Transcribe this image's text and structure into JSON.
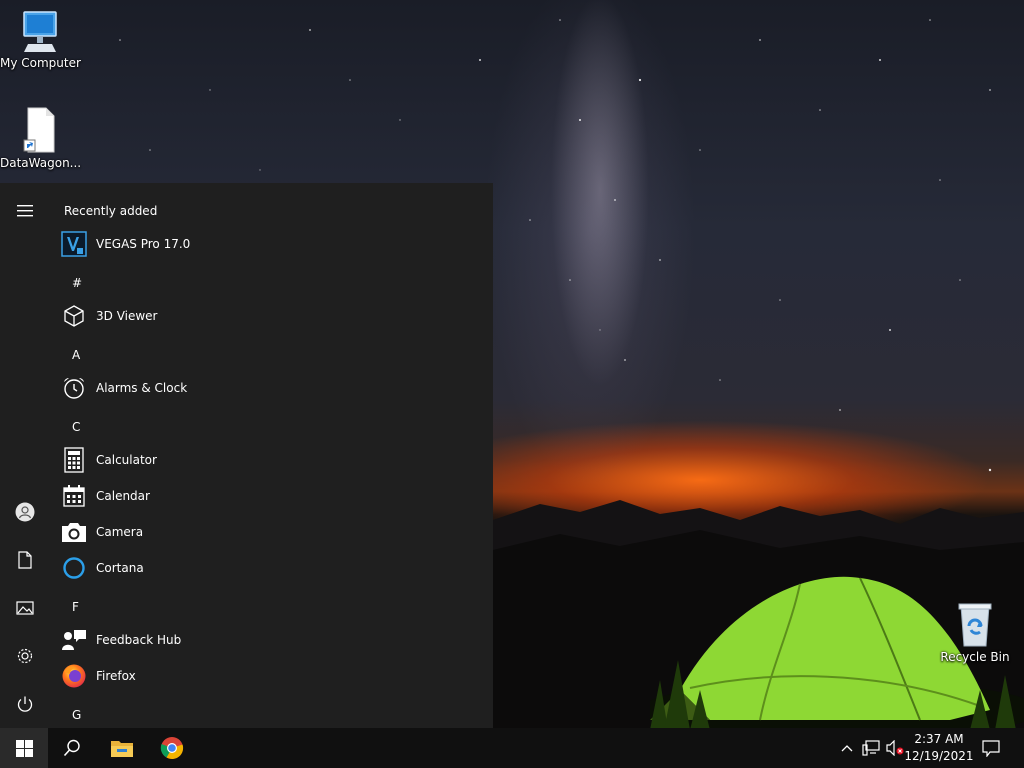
{
  "desktop": {
    "icons": [
      {
        "label": "My Computer",
        "icon": "monitor-icon"
      },
      {
        "label": "DataWagon...",
        "icon": "document-shortcut-icon"
      },
      {
        "label": "Recycle Bin",
        "icon": "recycle-bin-icon"
      }
    ]
  },
  "start_menu": {
    "recently_added_label": "Recently added",
    "letters": [
      "#",
      "A",
      "C",
      "F",
      "G"
    ],
    "apps": [
      {
        "name": "VEGAS Pro 17.0",
        "icon": "vegas-icon"
      },
      {
        "name": "3D Viewer",
        "icon": "cube-icon"
      },
      {
        "name": "Alarms & Clock",
        "icon": "alarm-clock-icon"
      },
      {
        "name": "Calculator",
        "icon": "calculator-icon"
      },
      {
        "name": "Calendar",
        "icon": "calendar-icon"
      },
      {
        "name": "Camera",
        "icon": "camera-icon"
      },
      {
        "name": "Cortana",
        "icon": "cortana-icon"
      },
      {
        "name": "Feedback Hub",
        "icon": "feedback-icon"
      },
      {
        "name": "Firefox",
        "icon": "firefox-icon"
      }
    ],
    "rail": [
      "hamburger-icon",
      "user-icon",
      "documents-icon",
      "pictures-icon",
      "settings-icon",
      "power-icon"
    ]
  },
  "taskbar": {
    "time": "2:37 AM",
    "date": "12/19/2021",
    "pinned": [
      "search-icon",
      "file-explorer-icon",
      "chrome-icon"
    ]
  },
  "colors": {
    "menu_bg": "#1f1f1f",
    "taskbar_bg": "#101010",
    "accent": "#0078d7"
  }
}
